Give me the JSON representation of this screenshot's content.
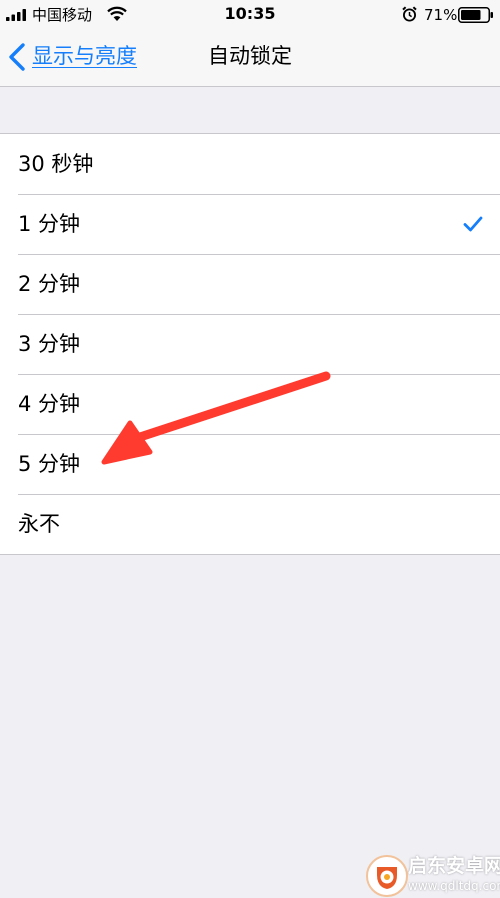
{
  "status_bar": {
    "carrier": "中国移动",
    "time": "10:35",
    "battery": "71%"
  },
  "nav": {
    "back_label": "显示与亮度",
    "title": "自动锁定"
  },
  "options": [
    {
      "label": "30 秒钟",
      "selected": false
    },
    {
      "label": "1 分钟",
      "selected": true
    },
    {
      "label": "2 分钟",
      "selected": false
    },
    {
      "label": "3 分钟",
      "selected": false
    },
    {
      "label": "4 分钟",
      "selected": false
    },
    {
      "label": "5 分钟",
      "selected": false
    },
    {
      "label": "永不",
      "selected": false
    }
  ],
  "watermark": {
    "brand": "启东安卓网",
    "url": "www.qdltdq.com"
  },
  "colors": {
    "accent": "#147efb",
    "annotation_arrow": "#ff3b30",
    "background": "#efeff4",
    "bar": "#f7f7f7",
    "separator": "#c8c7cc"
  }
}
